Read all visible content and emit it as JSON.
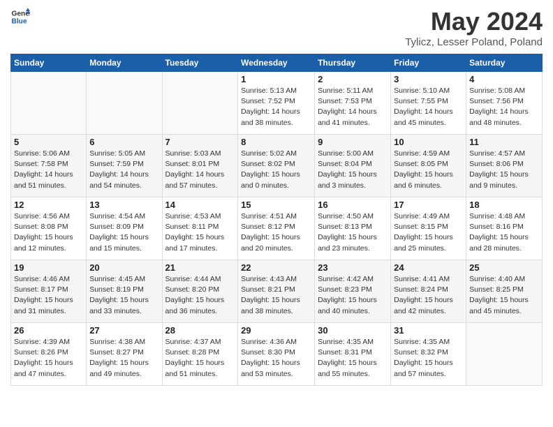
{
  "header": {
    "logo_general": "General",
    "logo_blue": "Blue",
    "month_title": "May 2024",
    "location": "Tylicz, Lesser Poland, Poland"
  },
  "days_of_week": [
    "Sunday",
    "Monday",
    "Tuesday",
    "Wednesday",
    "Thursday",
    "Friday",
    "Saturday"
  ],
  "weeks": [
    [
      {
        "day": "",
        "info": ""
      },
      {
        "day": "",
        "info": ""
      },
      {
        "day": "",
        "info": ""
      },
      {
        "day": "1",
        "info": "Sunrise: 5:13 AM\nSunset: 7:52 PM\nDaylight: 14 hours and 38 minutes."
      },
      {
        "day": "2",
        "info": "Sunrise: 5:11 AM\nSunset: 7:53 PM\nDaylight: 14 hours and 41 minutes."
      },
      {
        "day": "3",
        "info": "Sunrise: 5:10 AM\nSunset: 7:55 PM\nDaylight: 14 hours and 45 minutes."
      },
      {
        "day": "4",
        "info": "Sunrise: 5:08 AM\nSunset: 7:56 PM\nDaylight: 14 hours and 48 minutes."
      }
    ],
    [
      {
        "day": "5",
        "info": "Sunrise: 5:06 AM\nSunset: 7:58 PM\nDaylight: 14 hours and 51 minutes."
      },
      {
        "day": "6",
        "info": "Sunrise: 5:05 AM\nSunset: 7:59 PM\nDaylight: 14 hours and 54 minutes."
      },
      {
        "day": "7",
        "info": "Sunrise: 5:03 AM\nSunset: 8:01 PM\nDaylight: 14 hours and 57 minutes."
      },
      {
        "day": "8",
        "info": "Sunrise: 5:02 AM\nSunset: 8:02 PM\nDaylight: 15 hours and 0 minutes."
      },
      {
        "day": "9",
        "info": "Sunrise: 5:00 AM\nSunset: 8:04 PM\nDaylight: 15 hours and 3 minutes."
      },
      {
        "day": "10",
        "info": "Sunrise: 4:59 AM\nSunset: 8:05 PM\nDaylight: 15 hours and 6 minutes."
      },
      {
        "day": "11",
        "info": "Sunrise: 4:57 AM\nSunset: 8:06 PM\nDaylight: 15 hours and 9 minutes."
      }
    ],
    [
      {
        "day": "12",
        "info": "Sunrise: 4:56 AM\nSunset: 8:08 PM\nDaylight: 15 hours and 12 minutes."
      },
      {
        "day": "13",
        "info": "Sunrise: 4:54 AM\nSunset: 8:09 PM\nDaylight: 15 hours and 15 minutes."
      },
      {
        "day": "14",
        "info": "Sunrise: 4:53 AM\nSunset: 8:11 PM\nDaylight: 15 hours and 17 minutes."
      },
      {
        "day": "15",
        "info": "Sunrise: 4:51 AM\nSunset: 8:12 PM\nDaylight: 15 hours and 20 minutes."
      },
      {
        "day": "16",
        "info": "Sunrise: 4:50 AM\nSunset: 8:13 PM\nDaylight: 15 hours and 23 minutes."
      },
      {
        "day": "17",
        "info": "Sunrise: 4:49 AM\nSunset: 8:15 PM\nDaylight: 15 hours and 25 minutes."
      },
      {
        "day": "18",
        "info": "Sunrise: 4:48 AM\nSunset: 8:16 PM\nDaylight: 15 hours and 28 minutes."
      }
    ],
    [
      {
        "day": "19",
        "info": "Sunrise: 4:46 AM\nSunset: 8:17 PM\nDaylight: 15 hours and 31 minutes."
      },
      {
        "day": "20",
        "info": "Sunrise: 4:45 AM\nSunset: 8:19 PM\nDaylight: 15 hours and 33 minutes."
      },
      {
        "day": "21",
        "info": "Sunrise: 4:44 AM\nSunset: 8:20 PM\nDaylight: 15 hours and 36 minutes."
      },
      {
        "day": "22",
        "info": "Sunrise: 4:43 AM\nSunset: 8:21 PM\nDaylight: 15 hours and 38 minutes."
      },
      {
        "day": "23",
        "info": "Sunrise: 4:42 AM\nSunset: 8:23 PM\nDaylight: 15 hours and 40 minutes."
      },
      {
        "day": "24",
        "info": "Sunrise: 4:41 AM\nSunset: 8:24 PM\nDaylight: 15 hours and 42 minutes."
      },
      {
        "day": "25",
        "info": "Sunrise: 4:40 AM\nSunset: 8:25 PM\nDaylight: 15 hours and 45 minutes."
      }
    ],
    [
      {
        "day": "26",
        "info": "Sunrise: 4:39 AM\nSunset: 8:26 PM\nDaylight: 15 hours and 47 minutes."
      },
      {
        "day": "27",
        "info": "Sunrise: 4:38 AM\nSunset: 8:27 PM\nDaylight: 15 hours and 49 minutes."
      },
      {
        "day": "28",
        "info": "Sunrise: 4:37 AM\nSunset: 8:28 PM\nDaylight: 15 hours and 51 minutes."
      },
      {
        "day": "29",
        "info": "Sunrise: 4:36 AM\nSunset: 8:30 PM\nDaylight: 15 hours and 53 minutes."
      },
      {
        "day": "30",
        "info": "Sunrise: 4:35 AM\nSunset: 8:31 PM\nDaylight: 15 hours and 55 minutes."
      },
      {
        "day": "31",
        "info": "Sunrise: 4:35 AM\nSunset: 8:32 PM\nDaylight: 15 hours and 57 minutes."
      },
      {
        "day": "",
        "info": ""
      }
    ]
  ]
}
